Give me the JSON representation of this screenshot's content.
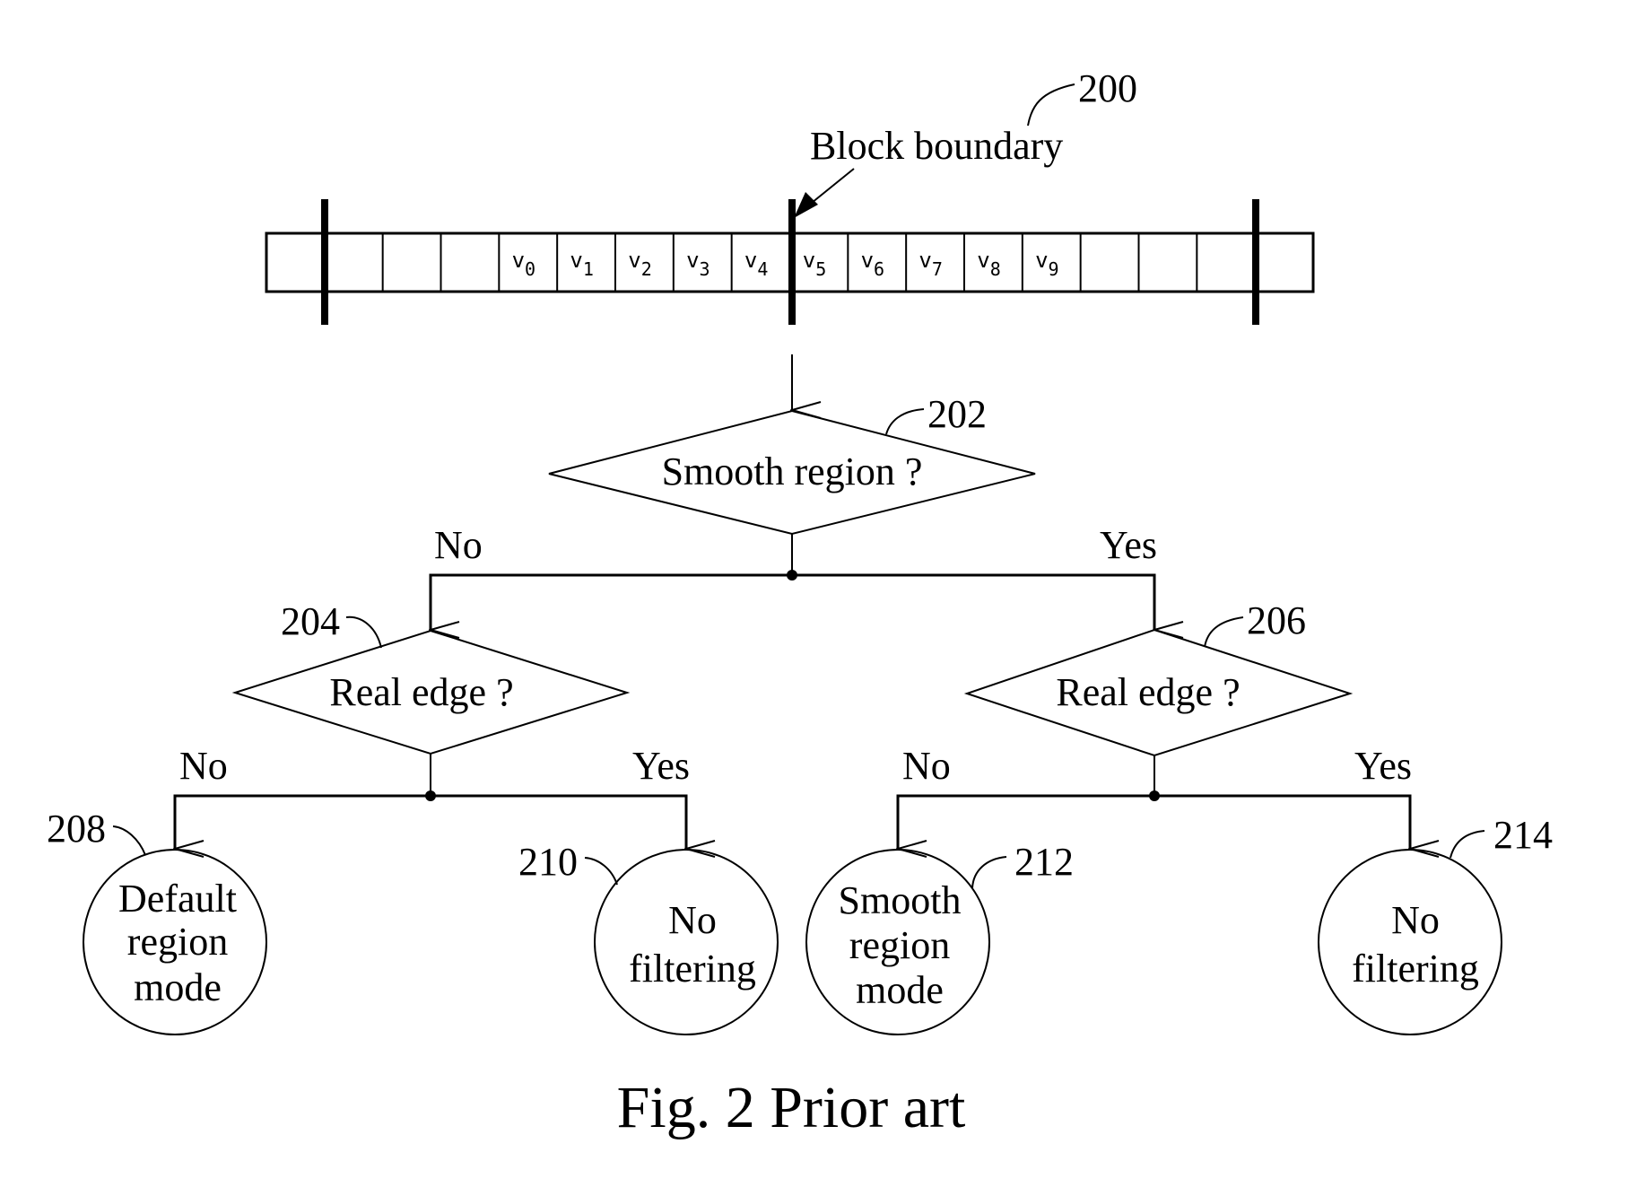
{
  "figure": {
    "caption": "Fig. 2 Prior art",
    "colors": {
      "ink": "#000000",
      "background": "#ffffff"
    }
  },
  "pixel_row": {
    "ref": "200",
    "boundary_label": "Block boundary",
    "cells": [
      "",
      "",
      "",
      "",
      "v0",
      "v1",
      "v2",
      "v3",
      "v4",
      "v5",
      "v6",
      "v7",
      "v8",
      "v9",
      "",
      "",
      "",
      ""
    ],
    "cell_symbols": [
      {
        "base": "v",
        "sub": "0"
      },
      {
        "base": "v",
        "sub": "1"
      },
      {
        "base": "v",
        "sub": "2"
      },
      {
        "base": "v",
        "sub": "3"
      },
      {
        "base": "v",
        "sub": "4"
      },
      {
        "base": "v",
        "sub": "5"
      },
      {
        "base": "v",
        "sub": "6"
      },
      {
        "base": "v",
        "sub": "7"
      },
      {
        "base": "v",
        "sub": "8"
      },
      {
        "base": "v",
        "sub": "9"
      }
    ]
  },
  "flowchart": {
    "d202": {
      "ref": "202",
      "text": "Smooth region ?"
    },
    "branch_main": {
      "no": "No",
      "yes": "Yes"
    },
    "d204": {
      "ref": "204",
      "text": "Real edge ?"
    },
    "d206": {
      "ref": "206",
      "text": "Real edge ?"
    },
    "branch_left": {
      "no": "No",
      "yes": "Yes"
    },
    "branch_right": {
      "no": "No",
      "yes": "Yes"
    },
    "t208": {
      "ref": "208",
      "lines": [
        "Default",
        "region",
        "mode"
      ]
    },
    "t210": {
      "ref": "210",
      "lines": [
        "No",
        "filtering"
      ]
    },
    "t212": {
      "ref": "212",
      "lines": [
        "Smooth",
        "region",
        "mode"
      ]
    },
    "t214": {
      "ref": "214",
      "lines": [
        "No",
        "filtering"
      ]
    }
  }
}
